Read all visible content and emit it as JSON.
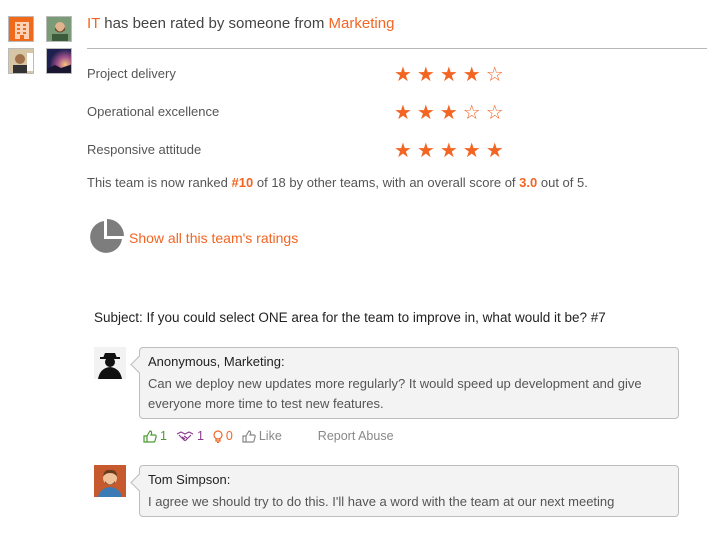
{
  "header": {
    "team_name": "IT",
    "rated_text": "has been rated by someone from",
    "rater_department": "Marketing"
  },
  "avatars": [
    "building-avatar",
    "bearded-man-avatar",
    "man-avatar",
    "sunset-avatar"
  ],
  "ratings": [
    {
      "label": "Project delivery",
      "stars": "★★★★☆",
      "score": 4
    },
    {
      "label": "Operational excellence",
      "stars": "★★★☆☆",
      "score": 3
    },
    {
      "label": "Responsive attitude",
      "stars": "★★★★★",
      "score": 5
    }
  ],
  "rank": {
    "prefix": "This team is now ranked",
    "position": "#10",
    "middle": "of 18 by other teams, with an overall score of",
    "score": "3.0",
    "suffix": "out of 5."
  },
  "show_all_label": "Show all this team's ratings",
  "subject": "Subject: If you could select ONE area for the team to improve in, what would it be? #7",
  "comments": [
    {
      "author": "Anonymous, Marketing:",
      "text": "Can we deploy new updates more regularly? It would speed up development and give everyone more time to test new features."
    },
    {
      "author": "Tom Simpson:",
      "text": "I agree we should try to do this. I'll have a word with the team at our next meeting"
    }
  ],
  "actions": {
    "agree_count": "1",
    "handshake_count": "1",
    "idea_count": "0",
    "like_label": "Like",
    "report_label": "Report Abuse"
  },
  "colors": {
    "accent": "#f26522",
    "agree": "#4a9a30",
    "handshake": "#8a3b8a"
  }
}
